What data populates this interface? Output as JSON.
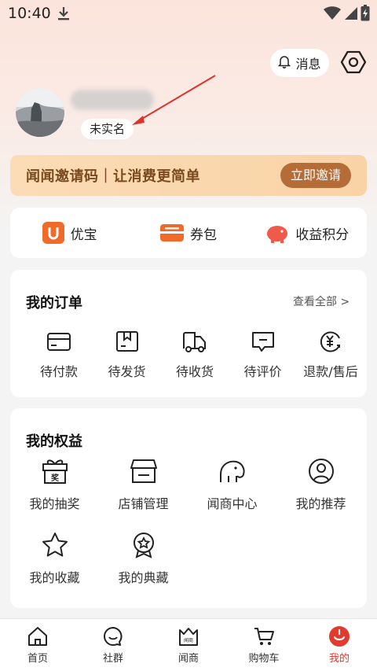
{
  "status_bar": {
    "time": "10:40"
  },
  "header": {
    "message_label": "消息"
  },
  "profile": {
    "realname_label": "未实名"
  },
  "banner": {
    "text": "闻闻邀请码｜让消费更简单",
    "button_label": "立即邀请"
  },
  "quick_links": [
    {
      "icon": "youbao-icon",
      "label": "优宝"
    },
    {
      "icon": "coupon-icon",
      "label": "券包"
    },
    {
      "icon": "piggy-bank-icon",
      "label": "收益积分"
    }
  ],
  "orders": {
    "title": "我的订单",
    "see_all": "查看全部 >",
    "items": [
      {
        "icon": "wallet-icon",
        "label": "待付款"
      },
      {
        "icon": "box-icon",
        "label": "待发货"
      },
      {
        "icon": "truck-icon",
        "label": "待收货"
      },
      {
        "icon": "comment-icon",
        "label": "待评价"
      },
      {
        "icon": "refund-icon",
        "label": "退款/售后"
      }
    ]
  },
  "rights": {
    "title": "我的权益",
    "items": [
      {
        "icon": "gift-icon",
        "label": "我的抽奖",
        "badge": "奖"
      },
      {
        "icon": "store-icon",
        "label": "店铺管理"
      },
      {
        "icon": "elephant-icon",
        "label": "闻商中心"
      },
      {
        "icon": "user-circle-icon",
        "label": "我的推荐"
      },
      {
        "icon": "star-icon",
        "label": "我的收藏"
      },
      {
        "icon": "medal-icon",
        "label": "我的典藏"
      }
    ]
  },
  "tabbar": [
    {
      "icon": "home-icon",
      "label": "首页",
      "active": false
    },
    {
      "icon": "community-icon",
      "label": "社群",
      "active": false
    },
    {
      "icon": "wenshang-icon",
      "label": "闻商",
      "badge": "闻商",
      "active": false
    },
    {
      "icon": "cart-icon",
      "label": "购物车",
      "active": false
    },
    {
      "icon": "profile-icon",
      "label": "我的",
      "active": true
    }
  ],
  "colors": {
    "accent": "#e23a2e",
    "banner_button": "#b56c37",
    "banner_text": "#7a4a1e",
    "quick_icon": "#f06a2a"
  }
}
